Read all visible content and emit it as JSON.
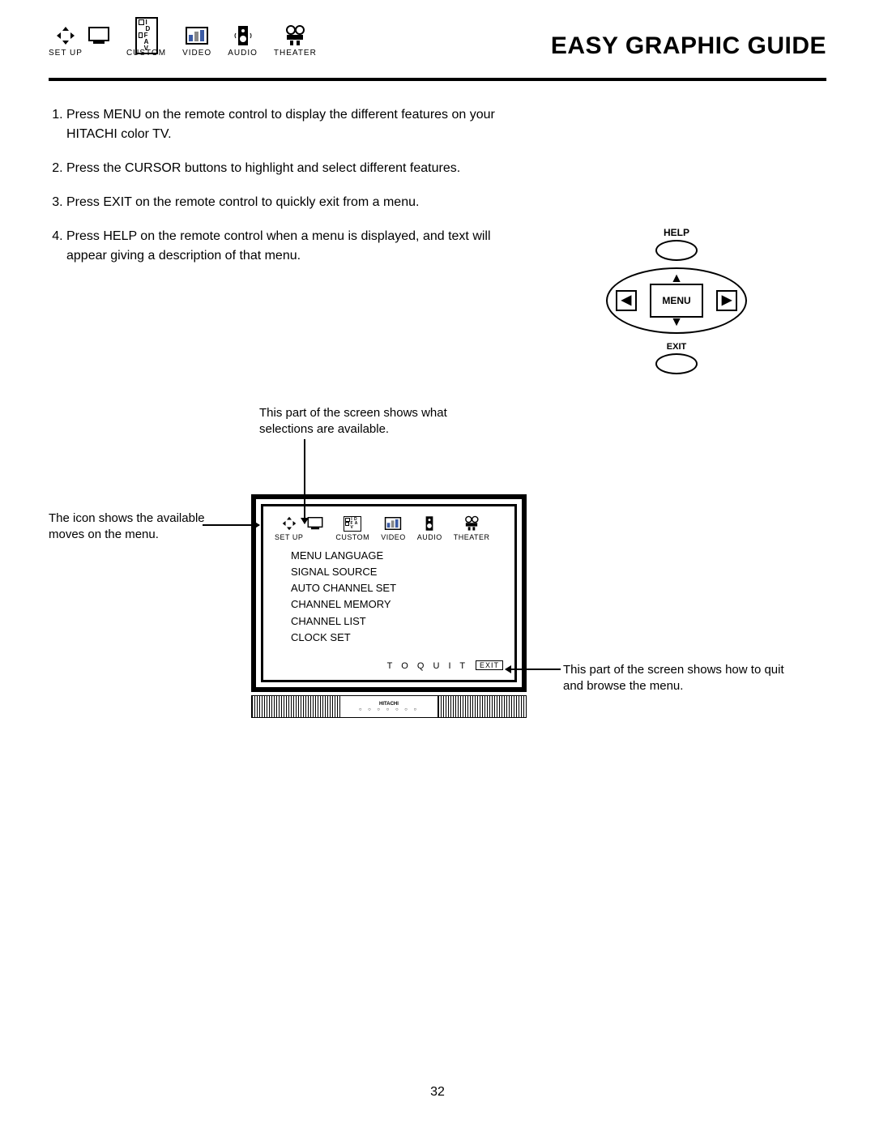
{
  "page_title": "EASY GRAPHIC GUIDE",
  "page_number": "32",
  "top_tabs": [
    "SET UP",
    "CUSTOM",
    "VIDEO",
    "AUDIO",
    "THEATER"
  ],
  "instructions": [
    "Press MENU on the remote control to display the different features on your HITACHI color TV.",
    "Press the CURSOR buttons to highlight and select different features.",
    "Press EXIT on the remote control to quickly exit from a menu.",
    "Press HELP on the remote control when a menu is displayed, and text will appear giving a description of that menu."
  ],
  "remote": {
    "help": "HELP",
    "menu": "MENU",
    "exit": "EXIT"
  },
  "callouts": {
    "top": "This part of the screen shows what selections are available.",
    "left": "The icon shows the available moves on the menu.",
    "right": "This part of the screen shows how to quit and browse the menu."
  },
  "tv": {
    "tabs": [
      "SET UP",
      "CUSTOM",
      "VIDEO",
      "AUDIO",
      "THEATER"
    ],
    "menu_items": [
      "MENU LANGUAGE",
      "SIGNAL SOURCE",
      "AUTO CHANNEL SET",
      "CHANNEL MEMORY",
      "CHANNEL LIST",
      "CLOCK SET"
    ],
    "quit_label": "T O   Q U I T",
    "exit_chip": "EXIT",
    "brand": "HITACHI"
  },
  "icons": {
    "custom_id": "I D",
    "custom_fav": "F A V"
  }
}
